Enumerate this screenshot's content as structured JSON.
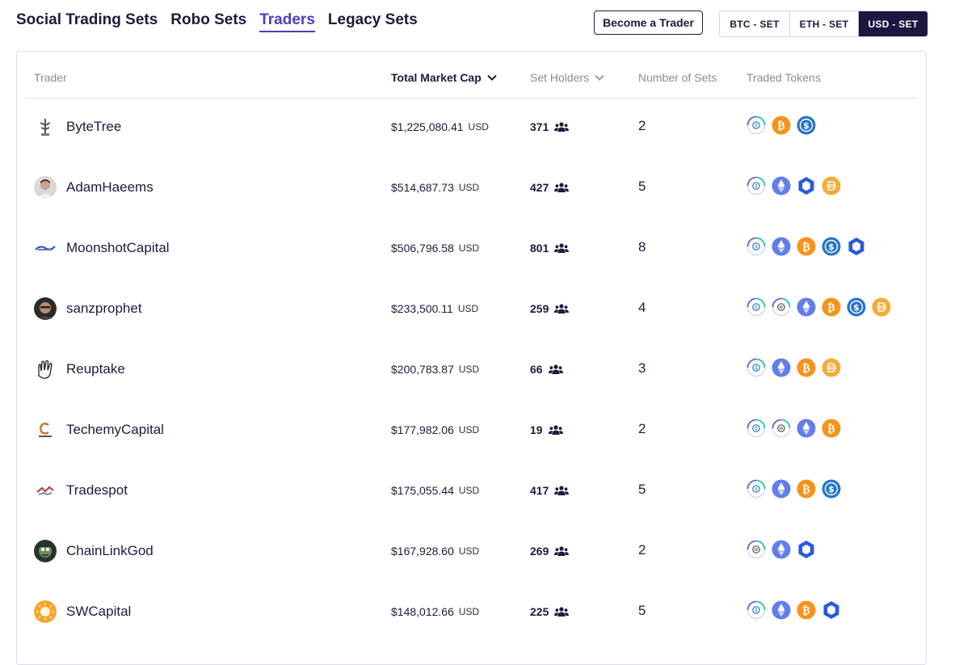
{
  "nav": {
    "tabs": [
      {
        "label": "Social Trading Sets",
        "active": false
      },
      {
        "label": "Robo Sets",
        "active": false
      },
      {
        "label": "Traders",
        "active": true
      },
      {
        "label": "Legacy Sets",
        "active": false
      }
    ],
    "become_trader_label": "Become a Trader",
    "currency_options": [
      {
        "label": "BTC - SET",
        "active": false
      },
      {
        "label": "ETH - SET",
        "active": false
      },
      {
        "label": "USD - SET",
        "active": true
      }
    ]
  },
  "table": {
    "headers": {
      "trader": "Trader",
      "market_cap": "Total Market Cap",
      "holders": "Set Holders",
      "sets": "Number of Sets",
      "tokens": "Traded Tokens"
    },
    "unit": "USD",
    "rows": [
      {
        "name": "ByteTree",
        "avatar": "bytetree-logo",
        "market_cap": "$1,225,080.41",
        "holders": "371",
        "sets": "2",
        "tokens": [
          "usdc-set",
          "btc",
          "usdc"
        ]
      },
      {
        "name": "AdamHaeems",
        "avatar": "person-photo",
        "market_cap": "$514,687.73",
        "holders": "427",
        "sets": "5",
        "tokens": [
          "usdc-set",
          "eth",
          "link",
          "dai"
        ]
      },
      {
        "name": "MoonshotCapital",
        "avatar": "moonshot-logo",
        "market_cap": "$506,796.58",
        "holders": "801",
        "sets": "8",
        "tokens": [
          "usdc-set",
          "eth",
          "btc",
          "usdc",
          "link"
        ]
      },
      {
        "name": "sanzprophet",
        "avatar": "person-photo-dark",
        "market_cap": "$233,500.11",
        "holders": "259",
        "sets": "4",
        "tokens": [
          "usdc-set",
          "dai-set",
          "eth",
          "btc",
          "usdc",
          "dai"
        ]
      },
      {
        "name": "Reuptake",
        "avatar": "hand-logo",
        "market_cap": "$200,783.87",
        "holders": "66",
        "sets": "3",
        "tokens": [
          "usdc-set",
          "eth",
          "btc",
          "dai"
        ]
      },
      {
        "name": "TechemyCapital",
        "avatar": "techemy-logo",
        "market_cap": "$177,982.06",
        "holders": "19",
        "sets": "2",
        "tokens": [
          "usdc-set",
          "dai-set",
          "eth",
          "btc"
        ]
      },
      {
        "name": "Tradespot",
        "avatar": "tradespot-logo",
        "market_cap": "$175,055.44",
        "holders": "417",
        "sets": "5",
        "tokens": [
          "usdc-set",
          "eth",
          "btc",
          "usdc"
        ]
      },
      {
        "name": "ChainLinkGod",
        "avatar": "cartoon-avatar",
        "market_cap": "$167,928.60",
        "holders": "269",
        "sets": "2",
        "tokens": [
          "dai-set",
          "eth",
          "link"
        ]
      },
      {
        "name": "SWCapital",
        "avatar": "sun-logo",
        "market_cap": "$148,012.66",
        "holders": "225",
        "sets": "5",
        "tokens": [
          "usdc-set",
          "eth",
          "btc",
          "link"
        ]
      }
    ]
  },
  "colors": {
    "accent": "#4a3fc1",
    "dark": "#1c1640",
    "btc": "#f7931a",
    "eth": "#627eea",
    "usdc": "#2775ca",
    "link": "#2a5ada",
    "dai": "#f5ac37"
  }
}
